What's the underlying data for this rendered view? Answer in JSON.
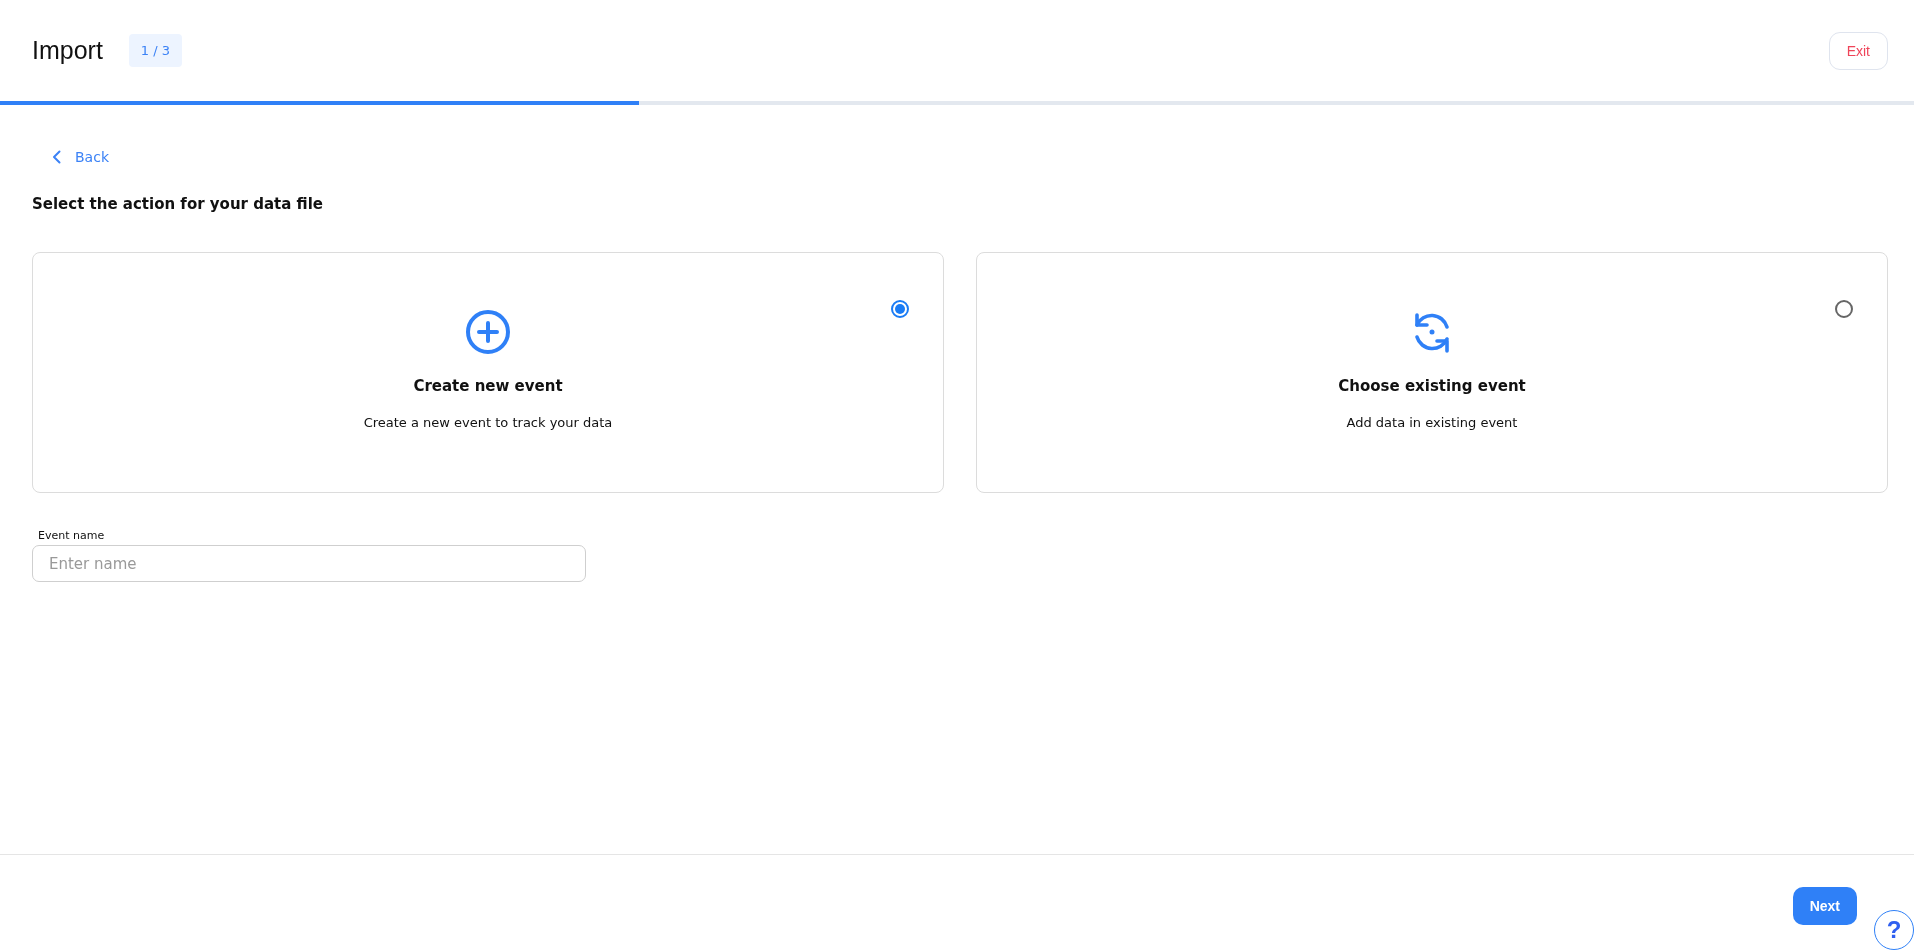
{
  "header": {
    "title": "Import",
    "step_badge": "1 / 3",
    "exit_button": "Exit"
  },
  "progress": {
    "level": 0.334
  },
  "back_link": "Back",
  "heading": "Select the action for your data file",
  "options": [
    {
      "kind": "create",
      "title": "Create new event",
      "description": "Create a new event to track your data",
      "selected": true
    },
    {
      "kind": "existing",
      "title": "Choose existing event",
      "description": "Add data in existing event",
      "selected": false
    }
  ],
  "event_name_field": {
    "label": "Event name",
    "placeholder": "Enter name"
  },
  "footer": {
    "next_button": "Next",
    "help_button": "?"
  }
}
